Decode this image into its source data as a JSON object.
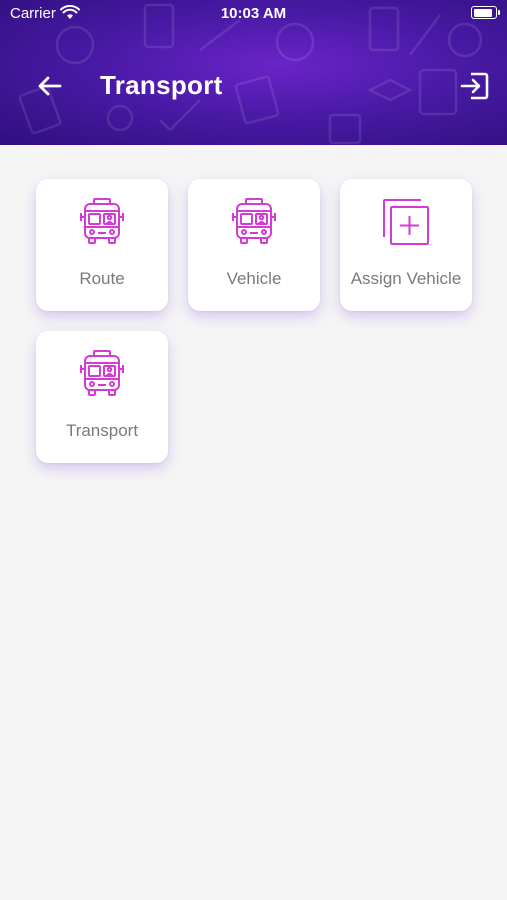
{
  "status_bar": {
    "carrier": "Carrier",
    "time": "10:03 AM",
    "battery_level": 0.9
  },
  "header": {
    "title": "Transport",
    "back_icon": "arrow-left-icon",
    "logout_icon": "logout-icon"
  },
  "colors": {
    "header_primary": "#4a1aa6",
    "accent": "#d63ad6",
    "card_text": "#7a7a7a"
  },
  "menu": [
    {
      "label": "Route",
      "icon": "bus-icon"
    },
    {
      "label": "Vehicle",
      "icon": "bus-icon"
    },
    {
      "label": "Assign Vehicle",
      "icon": "add-square-icon"
    },
    {
      "label": "Transport",
      "icon": "bus-icon"
    }
  ]
}
